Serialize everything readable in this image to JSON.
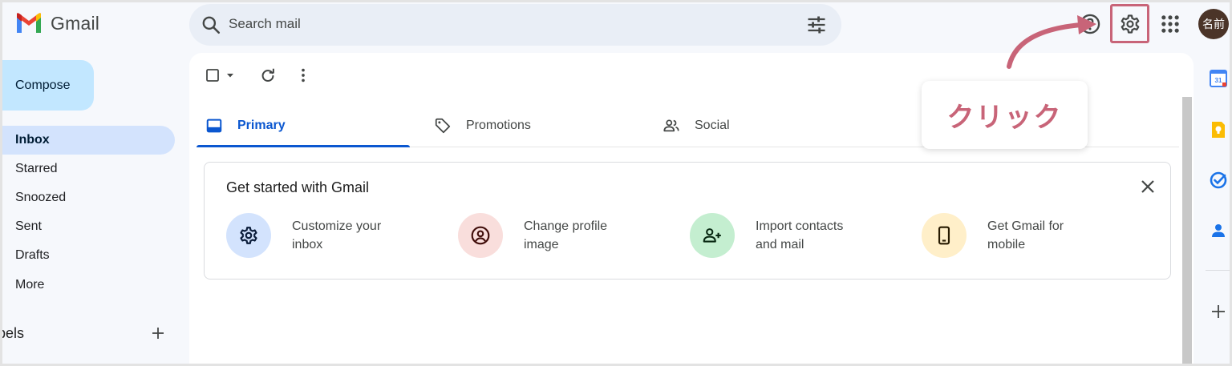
{
  "app": {
    "name": "Gmail"
  },
  "search": {
    "placeholder": "Search mail"
  },
  "header": {
    "avatar_text": "名前"
  },
  "sidebar": {
    "compose_label": "Compose",
    "items": [
      {
        "label": "Inbox"
      },
      {
        "label": "Starred"
      },
      {
        "label": "Snoozed"
      },
      {
        "label": "Sent"
      },
      {
        "label": "Drafts"
      },
      {
        "label": "More"
      }
    ],
    "labels_heading": "bels"
  },
  "tabs": [
    {
      "label": "Primary",
      "icon": "inbox-icon"
    },
    {
      "label": "Promotions",
      "icon": "tag-icon"
    },
    {
      "label": "Social",
      "icon": "people-icon"
    }
  ],
  "get_started": {
    "title": "Get started with Gmail",
    "items": [
      {
        "line1": "Customize your",
        "line2": "inbox",
        "icon": "gear-icon",
        "color": "#d3e3fd"
      },
      {
        "line1": "Change profile",
        "line2": "image",
        "icon": "account-circle-icon",
        "color": "#f9dedc"
      },
      {
        "line1": "Import contacts",
        "line2": "and mail",
        "icon": "person-add-icon",
        "color": "#c4eed0"
      },
      {
        "line1": "Get Gmail for",
        "line2": "mobile",
        "icon": "phone-icon",
        "color": "#ffefc9"
      }
    ]
  },
  "annotation": {
    "text": "クリック",
    "color": "#c86478"
  },
  "colors": {
    "accent": "#0b57d0",
    "compose_bg": "#c2e7ff",
    "active_nav": "#d3e3fd"
  }
}
